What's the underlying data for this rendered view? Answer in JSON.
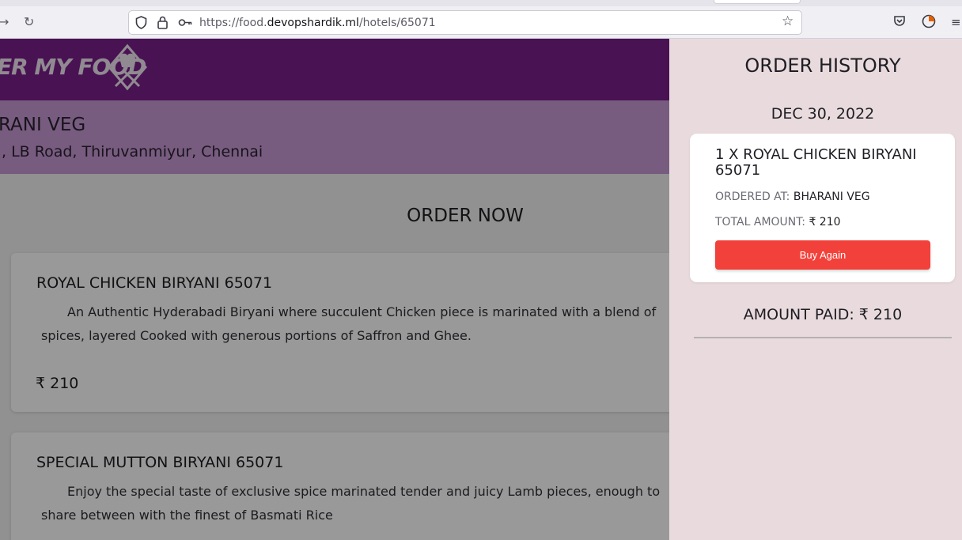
{
  "browser": {
    "url_scheme": "https://food.",
    "url_domain": "devopshardik.ml",
    "url_path": "/hotels/65071"
  },
  "site": {
    "logo_text": "ER MY FOOD"
  },
  "hotel": {
    "name": "RANI VEG",
    "address": ", LB Road, Thiruvanmiyur, Chennai"
  },
  "menu": {
    "heading": "ORDER NOW",
    "items": [
      {
        "title": "ROYAL CHICKEN BIRYANI 65071",
        "description": "An Authentic Hyderabadi Biryani where succulent Chicken piece is marinated with a blend of spices, layered Cooked with generous portions of Saffron and Ghee.",
        "price": "₹ 210"
      },
      {
        "title": "SPECIAL MUTTON BIRYANI 65071",
        "description": "Enjoy the special taste of exclusive spice marinated tender and juicy Lamb pieces, enough to share between with the finest of Basmati Rice"
      }
    ]
  },
  "order_history": {
    "title": "ORDER HISTORY",
    "date": "DEC 30, 2022",
    "orders": [
      {
        "item": "1 X ROYAL CHICKEN BIRYANI 65071",
        "ordered_at_label": "ORDERED AT:",
        "ordered_at_value": "BHARANI VEG",
        "total_label": "TOTAL AMOUNT:",
        "total_value": "₹ 210",
        "button_label": "Buy Again"
      }
    ],
    "amount_paid": "AMOUNT PAID: ₹ 210"
  },
  "colors": {
    "header": "#7a1f8a",
    "hotel_band": "#c79ad6",
    "drawer": "#e9dbdd",
    "buy_button": "#f2413a"
  }
}
